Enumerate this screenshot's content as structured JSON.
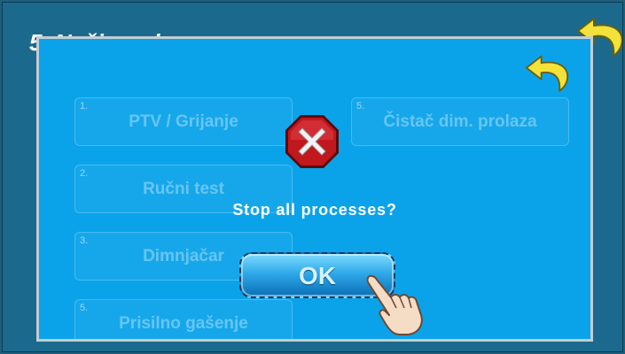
{
  "background": {
    "title": "5. Način rada"
  },
  "menu": [
    {
      "num": "1.",
      "label": "PTV / Grijanje"
    },
    {
      "num": "5.",
      "label": "Čistač dim. prolaza"
    },
    {
      "num": "2.",
      "label": "Ručni test"
    },
    {
      "num": "3.",
      "label": "Dimnjačar"
    },
    {
      "num": "5.",
      "label": "Prisilno gašenje"
    }
  ],
  "dialog": {
    "message": "Stop all processes?",
    "ok_label": "OK",
    "icon": "stop-x-icon"
  },
  "colors": {
    "dialog_bg": "#0aa3ea",
    "stop_red": "#c0181c",
    "back_arrow": "#f2e23a"
  }
}
